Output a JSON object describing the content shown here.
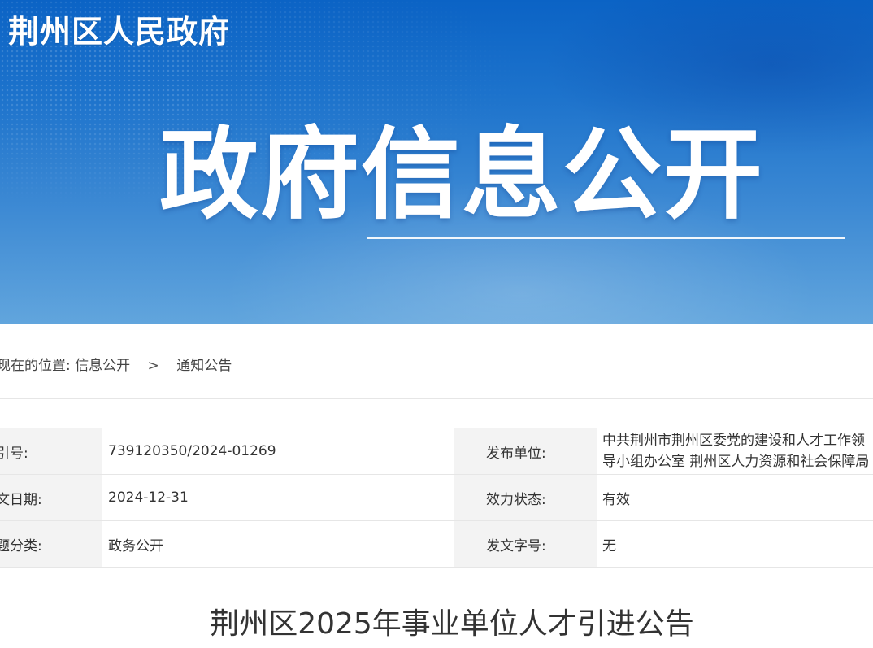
{
  "header": {
    "site_title": "荆州区人民政府",
    "section_title": "政府信息公开"
  },
  "breadcrumb": {
    "prefix": "现在的位置:",
    "items": [
      "信息公开",
      "通知公告"
    ],
    "separator": ">"
  },
  "meta": {
    "rows": [
      {
        "label1": "索引号:",
        "value1": "739120350/2024-01269",
        "label2": "发布单位:",
        "value2": "中共荆州市荆州区委党的建设和人才工作领导小组办公室 荆州区人力资源和社会保障局"
      },
      {
        "label1": "发文日期:",
        "value1": "2024-12-31",
        "label2": "效力状态:",
        "value2": "有效"
      },
      {
        "label1": "主题分类:",
        "value1": "政务公开",
        "label2": "发文字号:",
        "value2": "无"
      }
    ]
  },
  "article": {
    "title": "荆州区2025年事业单位人才引进公告"
  },
  "colors": {
    "banner_top": "#0b63c5",
    "banner_bottom": "#61a5dd",
    "label_bg": "#f3f3f3",
    "text": "#333333"
  }
}
